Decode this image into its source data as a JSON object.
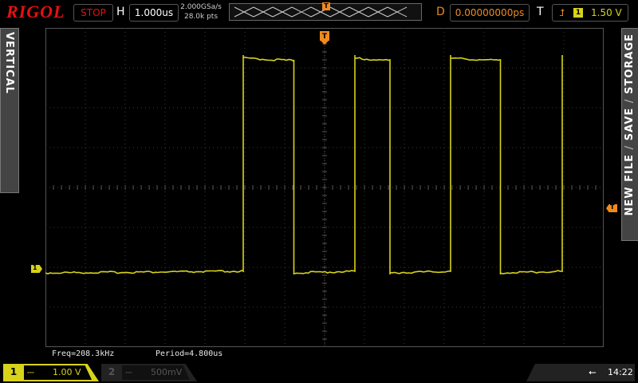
{
  "brand": "RIGOL",
  "run_state": "STOP",
  "horizontal": {
    "label": "H",
    "timebase": "1.000us"
  },
  "acquisition": {
    "sample_rate": "2.000GSa/s",
    "memory_depth": "28.0k pts"
  },
  "trigger_marker": "T",
  "delay": {
    "label": "D",
    "value": "0.00000000ps"
  },
  "trigger": {
    "label": "T",
    "edge_icon": "rising-edge-icon",
    "source": "1",
    "level": "1.50 V"
  },
  "side_left": {
    "label": "VERTICAL"
  },
  "side_right": {
    "labels": [
      "STORAGE",
      "SAVE",
      "NEW FILE"
    ]
  },
  "measurements": {
    "freq": "Freq=208.3kHz",
    "period": "Period=4.800us"
  },
  "channel1": {
    "number": "1",
    "coupling": "⎓",
    "scale": "1.00 V",
    "color": "#d7d31a"
  },
  "channel2": {
    "number": "2",
    "coupling": "⎓",
    "scale": "500mV"
  },
  "status": {
    "usb_icon": "usb-icon",
    "time": "14:22"
  },
  "colors": {
    "ch1": "#d7d31a",
    "trigger": "#f08a1c",
    "brand": "#e8100f",
    "grid": "#4a4a4a"
  },
  "waveform": {
    "type": "square",
    "frequency_khz": 208.3,
    "period_us": 4.8,
    "time_per_div_us": 1.0,
    "volts_per_div": 1.0,
    "high_level_div": 5.3,
    "low_level_div": 0.0,
    "trigger_level_v": 1.5,
    "edges_us": [
      -2.04,
      -0.77,
      0.76,
      1.64,
      3.16,
      4.41,
      5.96
    ]
  }
}
